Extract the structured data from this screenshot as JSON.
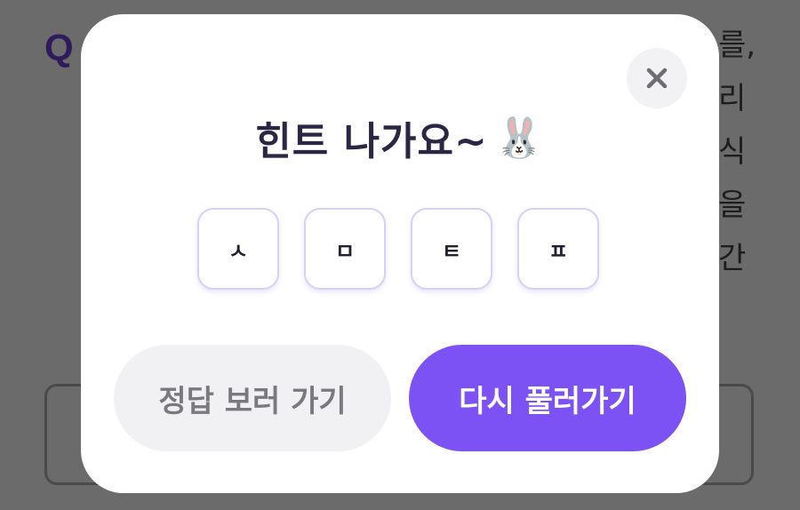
{
  "background": {
    "question_marker": "Q",
    "side_text": [
      "를,",
      "리",
      "식",
      "을",
      "간"
    ]
  },
  "modal": {
    "title": "힌트 나가요~",
    "title_emoji": "🐰",
    "hint_letters": [
      "ㅅ",
      "ㅁ",
      "ㅌ",
      "ㅍ"
    ],
    "close_icon": "close-icon",
    "secondary_button": "정답 보러 가기",
    "primary_button": "다시 풀러가기"
  },
  "colors": {
    "overlay": "#6b6b6b",
    "primary": "#7c52f4",
    "secondary_bg": "#f1f1f3",
    "title": "#2b2643",
    "tile_border": "#d6cff6"
  }
}
